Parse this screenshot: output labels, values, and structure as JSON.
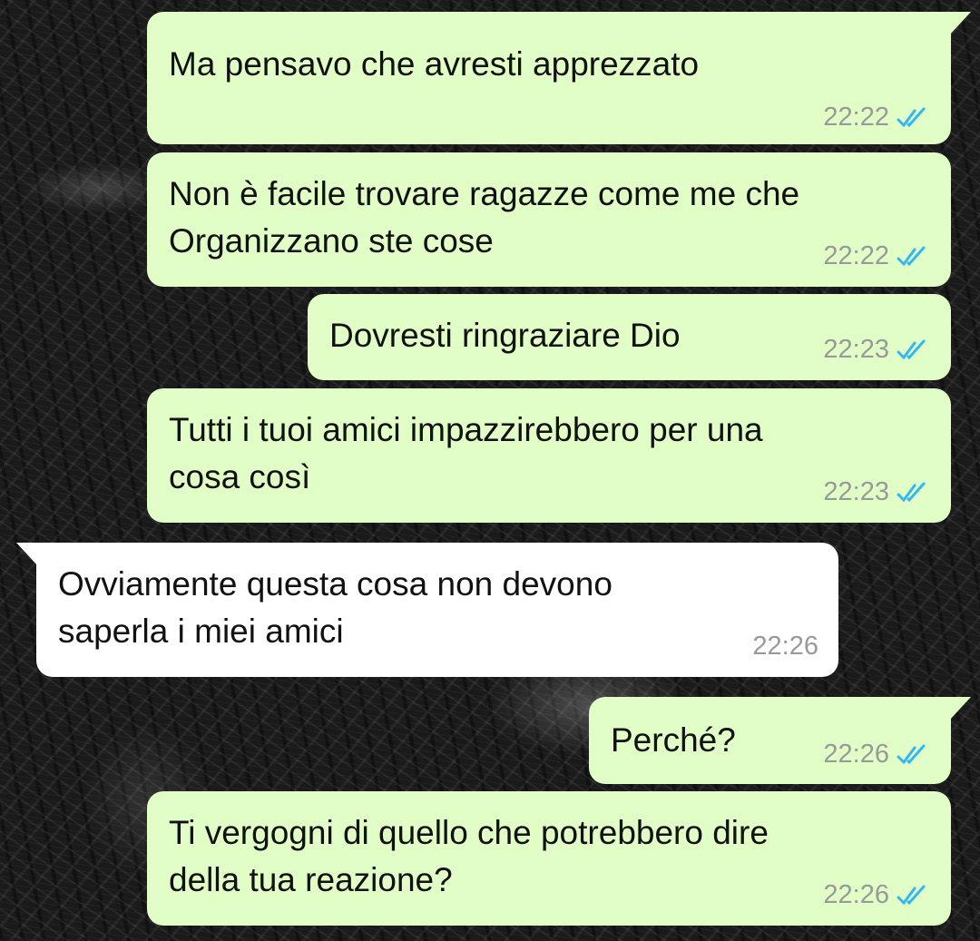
{
  "colors": {
    "outgoing_bubble": "#e1fec6",
    "incoming_bubble": "#ffffff",
    "timestamp": "#999999",
    "read_ticks": "#34b7f1"
  },
  "messages": [
    {
      "direction": "outgoing",
      "text": "Ma pensavo che avresti apprezzato",
      "time": "22:22",
      "status": "read",
      "status_icon": "double-check-icon"
    },
    {
      "direction": "outgoing",
      "text": "Non è facile trovare ragazze come me che\nOrganizzano ste cose",
      "time": "22:22",
      "status": "read",
      "status_icon": "double-check-icon"
    },
    {
      "direction": "outgoing",
      "text": "Dovresti ringraziare Dio",
      "time": "22:23",
      "status": "read",
      "status_icon": "double-check-icon"
    },
    {
      "direction": "outgoing",
      "text": "Tutti i tuoi amici impazzirebbero per una\ncosa così",
      "time": "22:23",
      "status": "read",
      "status_icon": "double-check-icon"
    },
    {
      "direction": "incoming",
      "text": "Ovviamente questa cosa non devono\nsaperla i miei amici",
      "time": "22:26"
    },
    {
      "direction": "outgoing",
      "text": "Perché?",
      "time": "22:26",
      "status": "read",
      "status_icon": "double-check-icon"
    },
    {
      "direction": "outgoing",
      "text": "Ti vergogni di quello che potrebbero dire\ndella tua reazione?",
      "time": "22:26",
      "status": "read",
      "status_icon": "double-check-icon"
    }
  ]
}
